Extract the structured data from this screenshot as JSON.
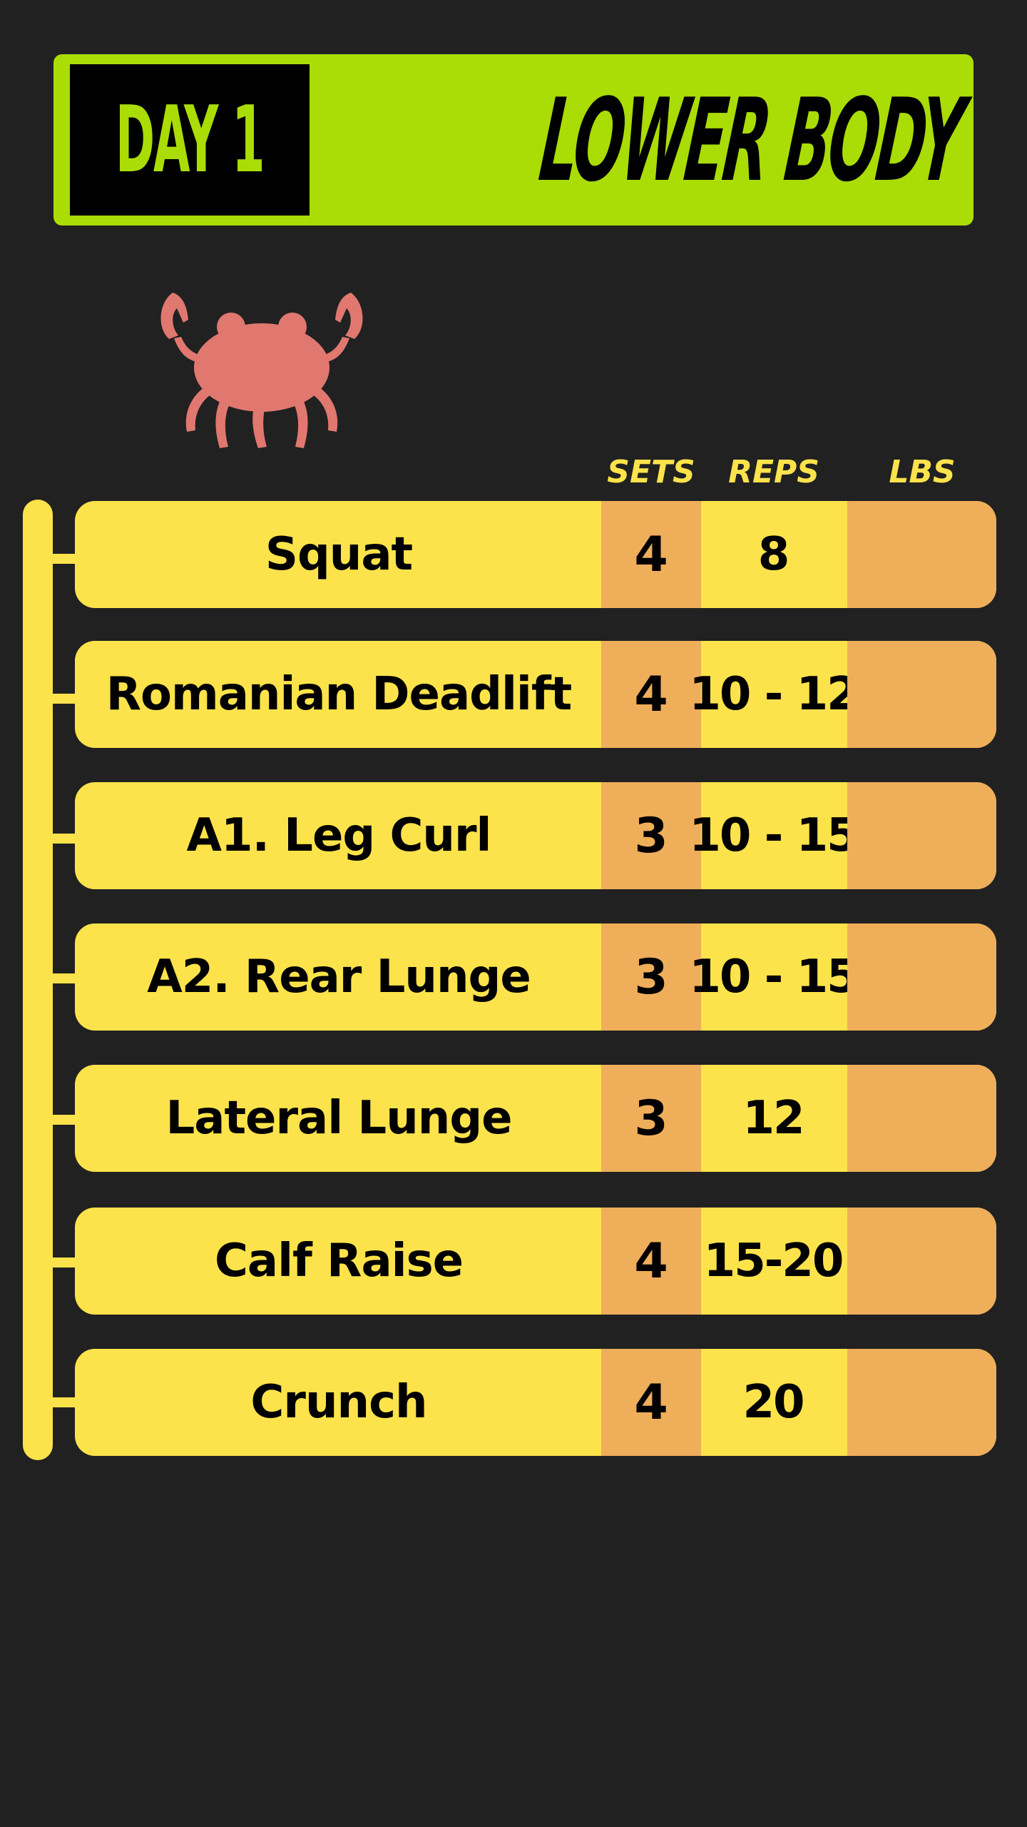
{
  "header": {
    "day_label": "DAY 1",
    "title": "LOWER BODY"
  },
  "mascot": {
    "icon": "crab-icon",
    "color": "#e07870"
  },
  "columns": {
    "sets": "SETS",
    "reps": "REPS",
    "lbs": "LBS"
  },
  "colors": {
    "background": "#212121",
    "accent_green": "#aadc05",
    "row_yellow": "#fde34b",
    "cell_orange": "#efae5a"
  },
  "exercises": [
    {
      "name": "Squat",
      "sets": "4",
      "reps": "8",
      "lbs": ""
    },
    {
      "name": "Romanian Deadlift",
      "sets": "4",
      "reps": "10 - 12",
      "lbs": ""
    },
    {
      "name": "A1. Leg Curl",
      "sets": "3",
      "reps": "10 - 15",
      "lbs": ""
    },
    {
      "name": "A2. Rear Lunge",
      "sets": "3",
      "reps": "10 - 15",
      "lbs": ""
    },
    {
      "name": "Lateral Lunge",
      "sets": "3",
      "reps": "12",
      "lbs": ""
    },
    {
      "name": "Calf Raise",
      "sets": "4",
      "reps": "15-20",
      "lbs": ""
    },
    {
      "name": "Crunch",
      "sets": "4",
      "reps": "20",
      "lbs": ""
    }
  ]
}
